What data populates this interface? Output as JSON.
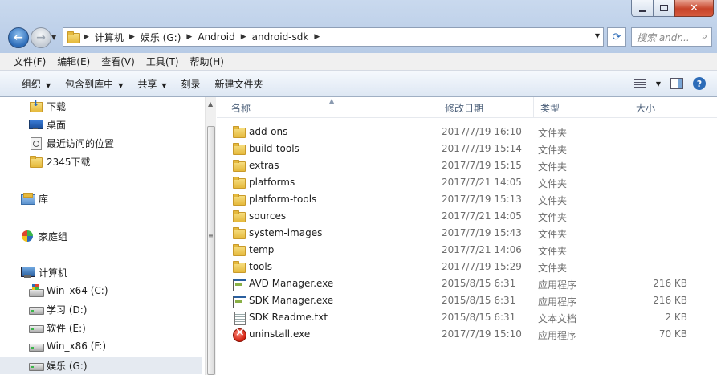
{
  "window": {
    "minimize_icon": "minimize-icon",
    "maximize_icon": "maximize-icon",
    "close_icon": "close-icon"
  },
  "address": {
    "crumbs": [
      "计算机",
      "娱乐 (G:)",
      "Android",
      "android-sdk"
    ],
    "search_placeholder": "搜索 andr..."
  },
  "menu": [
    "文件(F)",
    "编辑(E)",
    "查看(V)",
    "工具(T)",
    "帮助(H)"
  ],
  "commands": {
    "organize": "组织",
    "include_library": "包含到库中",
    "share": "共享",
    "burn": "刻录",
    "new_folder": "新建文件夹"
  },
  "nav": {
    "favorites": [
      {
        "label": "下载",
        "icon": "download-folder-icon"
      },
      {
        "label": "桌面",
        "icon": "desktop-icon"
      },
      {
        "label": "最近访问的位置",
        "icon": "recent-places-icon"
      },
      {
        "label": "2345下载",
        "icon": "folder-icon"
      }
    ],
    "library": "库",
    "homegroup": "家庭组",
    "computer": "计算机",
    "drives": [
      {
        "label": "Win_x64 (C:)",
        "icon": "system-drive-icon"
      },
      {
        "label": "学习 (D:)",
        "icon": "drive-icon"
      },
      {
        "label": "软件 (E:)",
        "icon": "drive-icon"
      },
      {
        "label": "Win_x86 (F:)",
        "icon": "drive-icon"
      },
      {
        "label": "娱乐 (G:)",
        "icon": "drive-icon",
        "selected": true
      }
    ]
  },
  "columns": {
    "name": "名称",
    "date": "修改日期",
    "type": "类型",
    "size": "大小"
  },
  "files": [
    {
      "name": "add-ons",
      "date": "2017/7/19 16:10",
      "type": "文件夹",
      "size": "",
      "icon": "folder-icon"
    },
    {
      "name": "build-tools",
      "date": "2017/7/19 15:14",
      "type": "文件夹",
      "size": "",
      "icon": "folder-icon"
    },
    {
      "name": "extras",
      "date": "2017/7/19 15:15",
      "type": "文件夹",
      "size": "",
      "icon": "folder-icon"
    },
    {
      "name": "platforms",
      "date": "2017/7/21 14:05",
      "type": "文件夹",
      "size": "",
      "icon": "folder-icon"
    },
    {
      "name": "platform-tools",
      "date": "2017/7/19 15:13",
      "type": "文件夹",
      "size": "",
      "icon": "folder-icon"
    },
    {
      "name": "sources",
      "date": "2017/7/21 14:05",
      "type": "文件夹",
      "size": "",
      "icon": "folder-icon"
    },
    {
      "name": "system-images",
      "date": "2017/7/19 15:43",
      "type": "文件夹",
      "size": "",
      "icon": "folder-icon"
    },
    {
      "name": "temp",
      "date": "2017/7/21 14:06",
      "type": "文件夹",
      "size": "",
      "icon": "folder-icon"
    },
    {
      "name": "tools",
      "date": "2017/7/19 15:29",
      "type": "文件夹",
      "size": "",
      "icon": "folder-icon"
    },
    {
      "name": "AVD Manager.exe",
      "date": "2015/8/15 6:31",
      "type": "应用程序",
      "size": "216 KB",
      "icon": "exe-icon"
    },
    {
      "name": "SDK Manager.exe",
      "date": "2015/8/15 6:31",
      "type": "应用程序",
      "size": "216 KB",
      "icon": "exe-icon"
    },
    {
      "name": "SDK Readme.txt",
      "date": "2015/8/15 6:31",
      "type": "文本文档",
      "size": "2 KB",
      "icon": "text-file-icon"
    },
    {
      "name": "uninstall.exe",
      "date": "2017/7/19 15:10",
      "type": "应用程序",
      "size": "70 KB",
      "icon": "uninstall-icon"
    }
  ]
}
